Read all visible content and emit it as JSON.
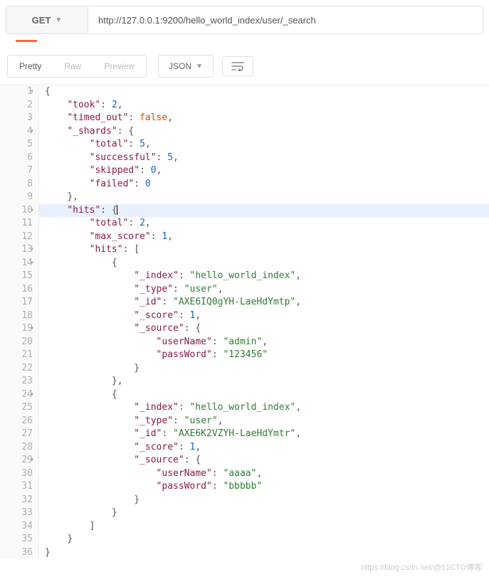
{
  "request": {
    "method": "GET",
    "url": "http://127.0.0.1:9200/hello_world_index/user/_search"
  },
  "view_tabs": {
    "pretty": "Pretty",
    "raw": "Raw",
    "preview": "Preview"
  },
  "format": {
    "label": "JSON"
  },
  "response": {
    "took": 2,
    "timed_out": false,
    "_shards": {
      "total": 5,
      "successful": 5,
      "skipped": 0,
      "failed": 0
    },
    "hits": {
      "total": 2,
      "max_score": 1,
      "hits": [
        {
          "_index": "hello_world_index",
          "_type": "user",
          "_id": "AXE6IQ0gYH-LaeHdYmtp",
          "_score": 1,
          "_source": {
            "userName": "admin",
            "passWord": "123456"
          }
        },
        {
          "_index": "hello_world_index",
          "_type": "user",
          "_id": "AXE6K2VZYH-LaeHdYmtr",
          "_score": 1,
          "_source": {
            "userName": "aaaa",
            "passWord": "bbbbb"
          }
        }
      ]
    }
  },
  "watermark": "https://blog.csdn.net/@51CTO博客"
}
